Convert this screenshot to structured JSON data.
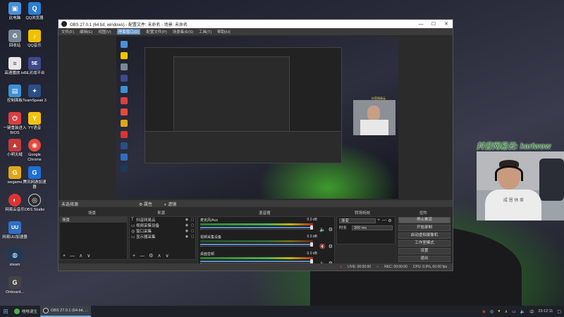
{
  "desktop": {
    "icons": [
      {
        "label": "此电脑",
        "color": "#4a90d9",
        "glyph": "▣"
      },
      {
        "label": "QQ浏览器",
        "color": "#2a7fd4",
        "glyph": "Q"
      },
      {
        "label": "回收站",
        "color": "#7a8796",
        "glyph": "♻"
      },
      {
        "label": "QQ音乐",
        "color": "#f2c200",
        "glyph": "♪"
      },
      {
        "label": "高速播放.txt",
        "color": "#e8e8e8",
        "glyph": "≡"
      },
      {
        "label": "5E对战平台",
        "color": "#3d4b8c",
        "glyph": "5E"
      },
      {
        "label": "控制面板",
        "color": "#3e8fd6",
        "glyph": "▤"
      },
      {
        "label": "TeamSpeak 3",
        "color": "#2b4f86",
        "glyph": "✦"
      },
      {
        "label": "一键重装进入BIOS",
        "color": "#d94040",
        "glyph": "⏻"
      },
      {
        "label": "YY语音",
        "color": "#f4c20d",
        "glyph": "Y"
      },
      {
        "label": "小明无缝",
        "color": "#c23b3b",
        "glyph": "▲"
      },
      {
        "label": "Google Chrome",
        "color": "#e64a3b",
        "glyph": "◉"
      },
      {
        "label": "wegame",
        "color": "#e0a818",
        "glyph": "G"
      },
      {
        "label": "腾讯网游加速器",
        "color": "#1e6fd8",
        "glyph": "G"
      },
      {
        "label": "网易云音乐",
        "color": "#d33",
        "glyph": "◐"
      },
      {
        "label": "OBS Studio",
        "color": "#2b2b2b",
        "glyph": "◎"
      },
      {
        "label": "网易UU加速器",
        "color": "#2f6fc2",
        "glyph": "UU"
      },
      {
        "label": "steam",
        "color": "#1b3a5c",
        "glyph": "◍"
      },
      {
        "label": "Onboard...",
        "color": "#444",
        "glyph": "G"
      }
    ]
  },
  "obs": {
    "window_title": "OBS 27.0.1 (64 bit, windows) - 配置文件: 未命名 - 场景: 未命名",
    "menu": [
      "文件(F)",
      "编辑(E)",
      "视图(V)",
      "停靠窗口(D)",
      "配置文件(P)",
      "场景集合(S)",
      "工具(T)",
      "帮助(H)"
    ],
    "active_menu_index": 3,
    "source_bar": {
      "label": "未选择源",
      "properties": "属性",
      "filters": "滤镜"
    },
    "docks": {
      "scenes": "场景",
      "sources": "来源",
      "mixer": "混音器",
      "transitions": "转场特效",
      "controls": "控件"
    },
    "scenes": [
      {
        "name": "场景",
        "selected": true
      }
    ],
    "sources": [
      {
        "icon": "T",
        "name": "抖音网易云"
      },
      {
        "icon": "▭",
        "name": "视频采集设备"
      },
      {
        "icon": "◎",
        "name": "窗口采集"
      },
      {
        "icon": "▭",
        "name": "显示器采集"
      }
    ],
    "mixer": [
      {
        "name": "麦克风/Aux",
        "db": "0.0 dB",
        "live": true,
        "muted": false
      },
      {
        "name": "视频采集设备",
        "db": "0.0 dB",
        "live": false,
        "muted": true
      },
      {
        "name": "桌面音频",
        "db": "0.0 dB",
        "live": true,
        "muted": false
      }
    ],
    "transitions": {
      "type": "渐变",
      "duration_label": "时长",
      "duration": "300 ms"
    },
    "controls": [
      "停止推流",
      "开始录制",
      "启动虚拟摄像机",
      "工作室模式",
      "设置",
      "退出"
    ],
    "status": {
      "live": "LIVE: 00:00:00",
      "rec": "REC: 00:00:00",
      "cpu": "CPU: 0.9%, 60.00 fps"
    },
    "preview_overlay_tag": "抖音网易云"
  },
  "overlay": {
    "caption": "抖音网易云: karlwow",
    "shirt_text": "成 恩 休 差"
  },
  "taskbar": {
    "items": [
      {
        "label": "啥啥请生",
        "color": "#4caf50",
        "active": false
      },
      {
        "label": "OBS 27.0.1 (64-bit, ...",
        "color": "#2b2b2b",
        "active": true
      }
    ],
    "clock": "23:12:11"
  }
}
